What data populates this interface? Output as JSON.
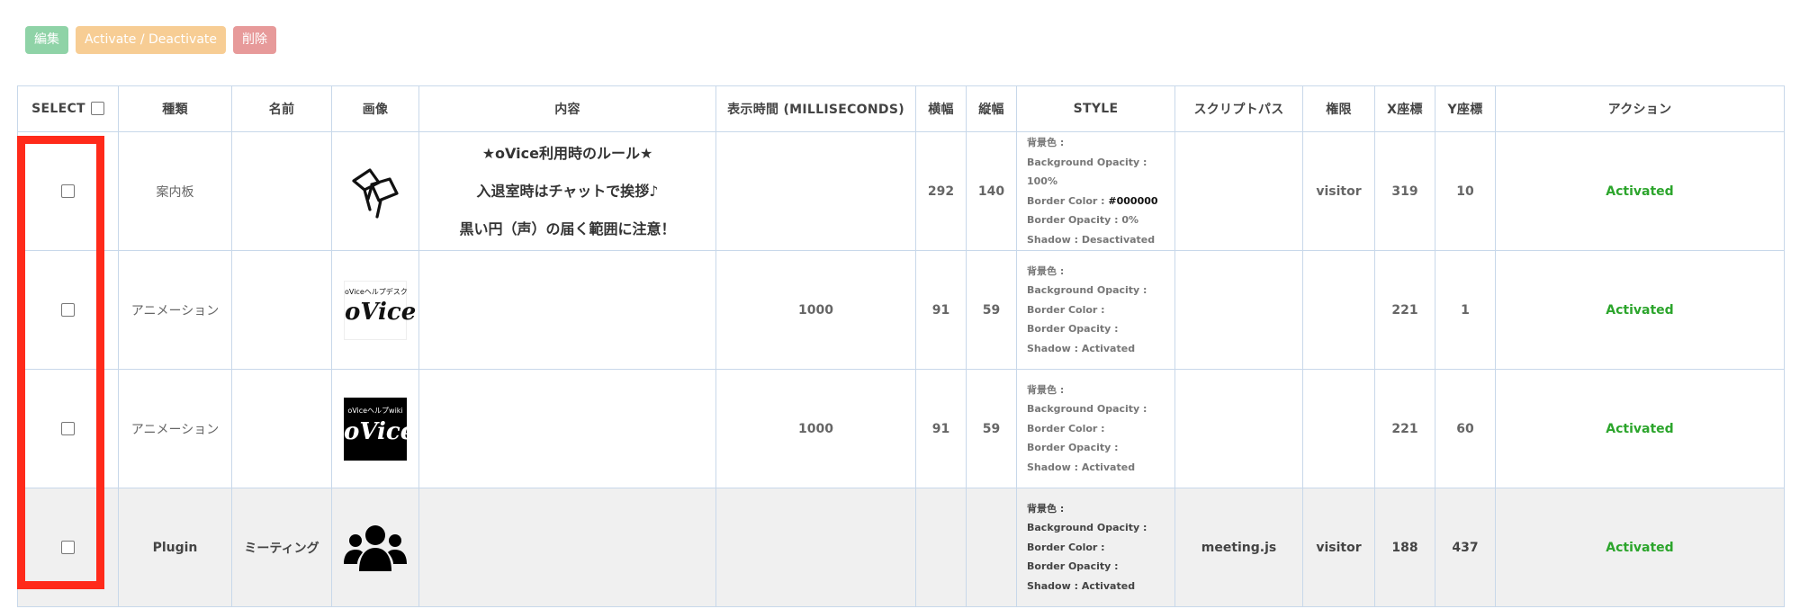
{
  "toolbar": {
    "edit_label": "編集",
    "toggle_label": "Activate / Deactivate",
    "delete_label": "削除"
  },
  "columns": {
    "select": "SELECT",
    "type": "種類",
    "name": "名前",
    "image": "画像",
    "content": "内容",
    "duration": "表示時間 (MILLISECONDS)",
    "width": "横幅",
    "height": "縦幅",
    "style": "STYLE",
    "script_path": "スクリプトパス",
    "permission": "権限",
    "x": "X座標",
    "y": "Y座標",
    "action": "アクション"
  },
  "rows": [
    {
      "type": "案内板",
      "name": "",
      "image_icon": "signboard-icon",
      "content": [
        "★oVice利用時のルール★",
        "入退室時はチャットで挨拶♪",
        "黒い円（声）の届く範囲に注意！"
      ],
      "duration": "",
      "width": "292",
      "height": "140",
      "style": {
        "bg_label": "背景色 :",
        "bg_opacity_label": "Background Opacity : 100%",
        "border_color_label": "Border Color : ",
        "border_color_value": "#000000",
        "border_opacity_label": "Border Opacity : 0%",
        "shadow_label": "Shadow : Desactivated"
      },
      "script_path": "",
      "permission": "visitor",
      "x": "319",
      "y": "10",
      "status": "Activated"
    },
    {
      "type": "アニメーション",
      "name": "",
      "image_icon": "ovice-helpdesk-logo",
      "image_caption": "oViceヘルプデスク",
      "image_word": "oVice",
      "content": [],
      "duration": "1000",
      "width": "91",
      "height": "59",
      "style": {
        "bg_label": "背景色 :",
        "bg_opacity_label": "Background Opacity :",
        "border_color_label": "Border Color :",
        "border_opacity_label": "Border Opacity :",
        "shadow_label": "Shadow : Activated"
      },
      "script_path": "",
      "permission": "",
      "x": "221",
      "y": "1",
      "status": "Activated"
    },
    {
      "type": "アニメーション",
      "name": "",
      "image_icon": "ovice-helpwiki-logo",
      "image_caption": "oViceヘルプwiki",
      "image_word": "oVice",
      "content": [],
      "duration": "1000",
      "width": "91",
      "height": "59",
      "style": {
        "bg_label": "背景色 :",
        "bg_opacity_label": "Background Opacity :",
        "border_color_label": "Border Color :",
        "border_opacity_label": "Border Opacity :",
        "shadow_label": "Shadow : Activated"
      },
      "script_path": "",
      "permission": "",
      "x": "221",
      "y": "60",
      "status": "Activated"
    },
    {
      "type": "Plugin",
      "name": "ミーティング",
      "image_icon": "group-icon",
      "content": [],
      "duration": "",
      "width": "",
      "height": "",
      "style": {
        "bg_label": "背景色 :",
        "bg_opacity_label": "Background Opacity :",
        "border_color_label": "Border Color :",
        "border_opacity_label": "Border Opacity :",
        "shadow_label": "Shadow : Activated"
      },
      "script_path": "meeting.js",
      "permission": "visitor",
      "x": "188",
      "y": "437",
      "status": "Activated"
    }
  ],
  "colors": {
    "edit_button": "#8fd3a7",
    "toggle_button": "#f7cd94",
    "delete_button": "#e79a9a",
    "status_activated": "#2ca52c",
    "highlight_box": "#ff2a1a",
    "table_border": "#c8d8ea"
  }
}
